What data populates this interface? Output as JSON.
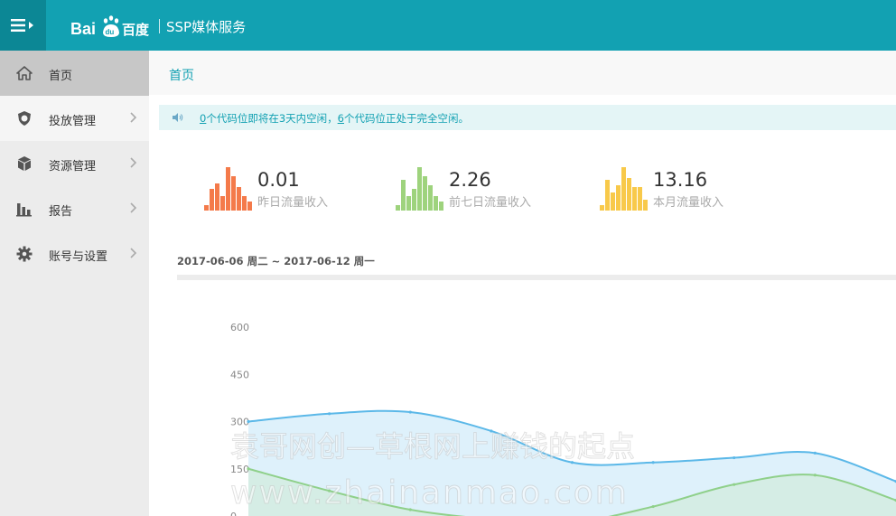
{
  "header": {
    "logo_text": "Bai du 百度",
    "title": "SSP媒体服务",
    "menu_icon": "hamburger-icon",
    "bg_color": "#12a1b2"
  },
  "sidebar": {
    "items": [
      {
        "label": "首页",
        "icon": "home-icon"
      },
      {
        "label": "投放管理",
        "icon": "shield-icon"
      },
      {
        "label": "资源管理",
        "icon": "cube-icon"
      },
      {
        "label": "报告",
        "icon": "bar-chart-icon"
      },
      {
        "label": "账号与设置",
        "icon": "gear-icon"
      }
    ]
  },
  "breadcrumb": {
    "current": "首页"
  },
  "notice": {
    "icon": "speaker-icon",
    "count1": "0",
    "text1": "个代码位即将在3天内空闲，",
    "count2": "6",
    "text2": "个代码位正处于完全空闲。"
  },
  "stats": [
    {
      "value": "0.01",
      "label": "昨日流量收入",
      "color": "#f47a4a"
    },
    {
      "value": "2.26",
      "label": "前七日流量收入",
      "color": "#9ed37d"
    },
    {
      "value": "13.16",
      "label": "本月流量收入",
      "color": "#f8c94a"
    }
  ],
  "date_range": "2017-06-06 周二 ~ 2017-06-12 周一",
  "chart_data": {
    "type": "area",
    "y_ticks": [
      "600",
      "450",
      "300",
      "150",
      "0"
    ],
    "ylim": [
      0,
      600
    ],
    "series": [
      {
        "values": [
          300,
          325,
          330,
          270,
          170,
          170,
          185,
          200,
          110
        ],
        "color": "#5bb8e8",
        "fill": "#dcf0fb"
      },
      {
        "values": [
          150,
          80,
          20,
          -10,
          -20,
          30,
          100,
          130,
          50
        ],
        "color": "#8fd08a",
        "fill": "#d3ece1"
      }
    ]
  },
  "watermark": {
    "line1": "袁哥网创—草根网上赚钱的起点",
    "line2": "www.zhainanmao.com"
  }
}
